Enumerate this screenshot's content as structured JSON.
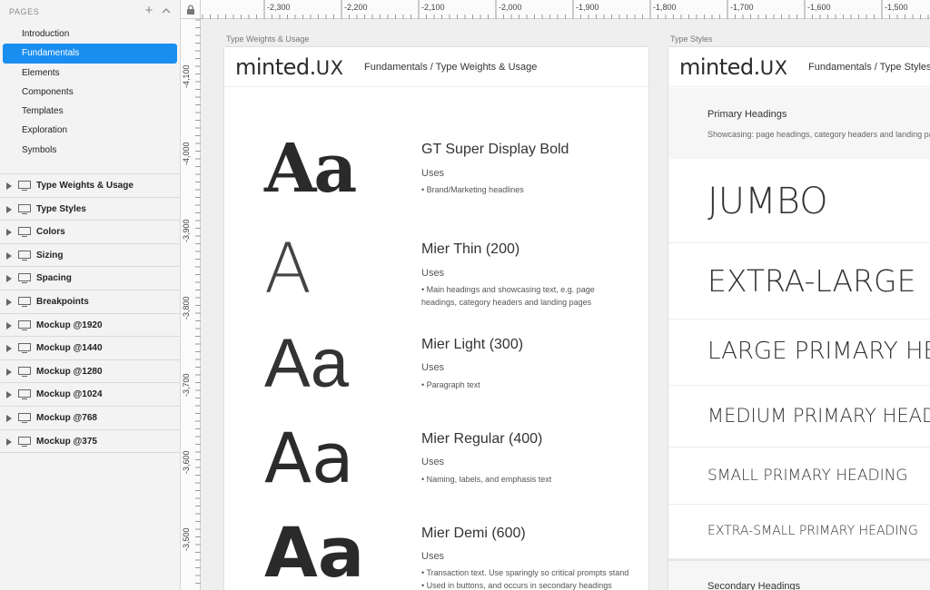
{
  "sidebar": {
    "pages_title": "PAGES",
    "add_symbol": "+",
    "pages": [
      {
        "label": "Introduction"
      },
      {
        "label": "Fundamentals",
        "active": true
      },
      {
        "label": "Elements"
      },
      {
        "label": "Components"
      },
      {
        "label": "Templates"
      },
      {
        "label": "Exploration"
      },
      {
        "label": "Symbols"
      }
    ],
    "layers": [
      {
        "label": "Type Weights & Usage"
      },
      {
        "label": "Type Styles"
      },
      {
        "label": "Colors"
      },
      {
        "label": "Sizing"
      },
      {
        "label": "Spacing"
      },
      {
        "label": "Breakpoints"
      },
      {
        "label": "Mockup @1920"
      },
      {
        "label": "Mockup @1440"
      },
      {
        "label": "Mockup @1280"
      },
      {
        "label": "Mockup @1024"
      },
      {
        "label": "Mockup @768"
      },
      {
        "label": "Mockup @375"
      }
    ]
  },
  "rulers": {
    "horizontal": [
      "-2,300",
      "-2,200",
      "-2,100",
      "-2,000",
      "-1,900",
      "-1,800",
      "-1,700",
      "-1,600",
      "-1,500"
    ],
    "vertical": [
      "-4,100",
      "-4,000",
      "-3,900",
      "-3,800",
      "-3,700",
      "-3,600",
      "-3,500"
    ]
  },
  "artboards": {
    "weights": {
      "label": "Type Weights & Usage",
      "logo_main": "minted.",
      "logo_ux": "UX",
      "breadcrumb": "Fundamentals / Type Weights & Usage",
      "entries": [
        {
          "sample": "Aa",
          "name": "GT Super Display Bold",
          "uses": "Uses",
          "bullets": [
            "• Brand/Marketing headlines"
          ]
        },
        {
          "sample": "A",
          "name": "Mier Thin (200)",
          "uses": "Uses",
          "bullets": [
            "• Main headings and showcasing text, e.g. page",
            "headings, category headers and landing pages"
          ]
        },
        {
          "sample": "Aa",
          "name": "Mier Light (300)",
          "uses": "Uses",
          "bullets": [
            "• Paragraph text"
          ]
        },
        {
          "sample": "Aa",
          "name": "Mier Regular (400)",
          "uses": "Uses",
          "bullets": [
            "• Naming, labels, and emphasis text"
          ]
        },
        {
          "sample": "Aa",
          "name": "Mier Demi (600)",
          "uses": "Uses",
          "bullets": [
            "• Transaction text. Use sparingly so critical prompts stand",
            "• Used in buttons, and occurs in secondary headings"
          ]
        }
      ]
    },
    "styles": {
      "label": "Type Styles",
      "logo_main": "minted.",
      "logo_ux": "UX",
      "breadcrumb": "Fundamentals / Type Styles",
      "section_title": "Primary Headings",
      "section_desc": "Showcasing: page headings, category headers and landing pages",
      "headings": [
        "JUMBO",
        "EXTRA-LARGE",
        "LARGE PRIMARY HEADING",
        "MEDIUM PRIMARY HEADING",
        "SMALL PRIMARY HEADING",
        "EXTRA-SMALL PRIMARY HEADING"
      ],
      "secondary_title": "Secondary Headings"
    }
  }
}
